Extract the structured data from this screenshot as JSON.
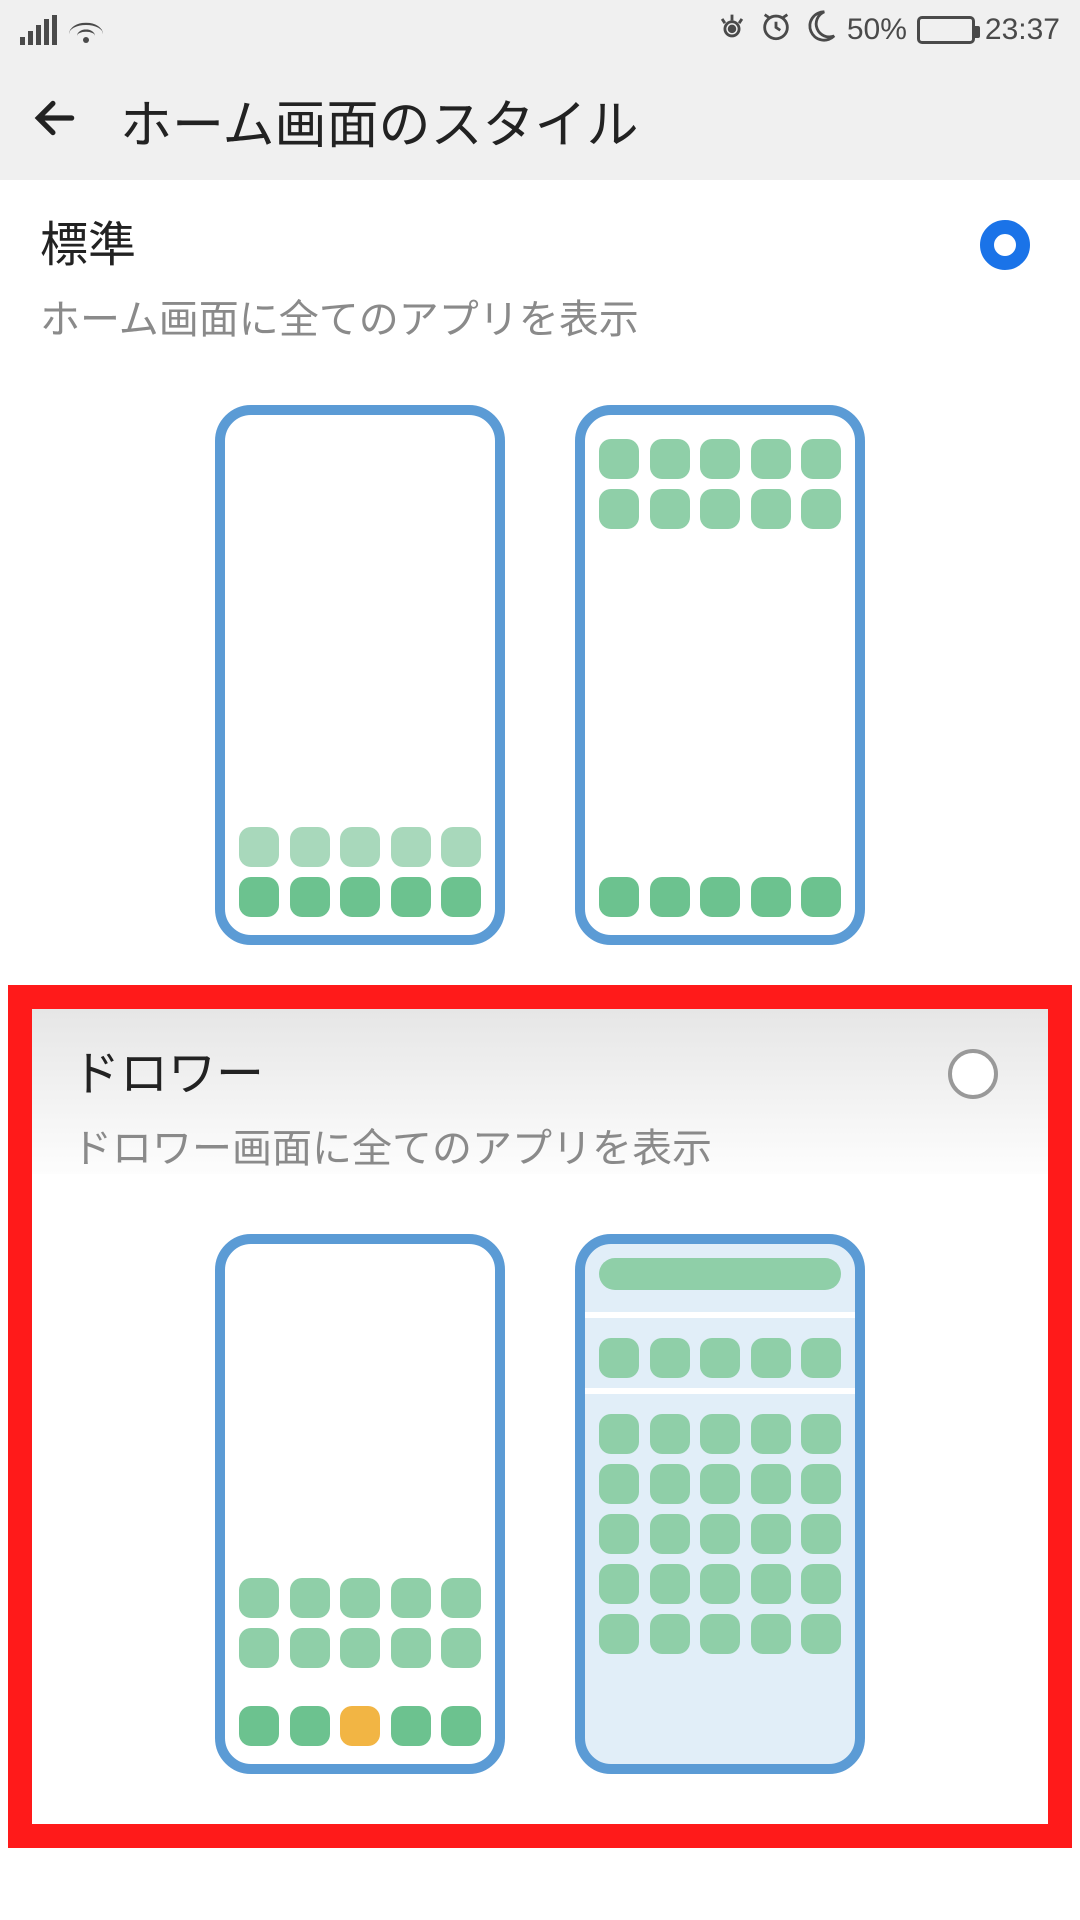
{
  "status": {
    "battery_pct": "50%",
    "time": "23:37"
  },
  "header": {
    "title": "ホーム画面のスタイル"
  },
  "options": [
    {
      "key": "standard",
      "title": "標準",
      "subtitle": "ホーム画面に全てのアプリを表示",
      "selected": true
    },
    {
      "key": "drawer",
      "title": "ドロワー",
      "subtitle": "ドロワー画面に全てのアプリを表示",
      "selected": false
    }
  ]
}
